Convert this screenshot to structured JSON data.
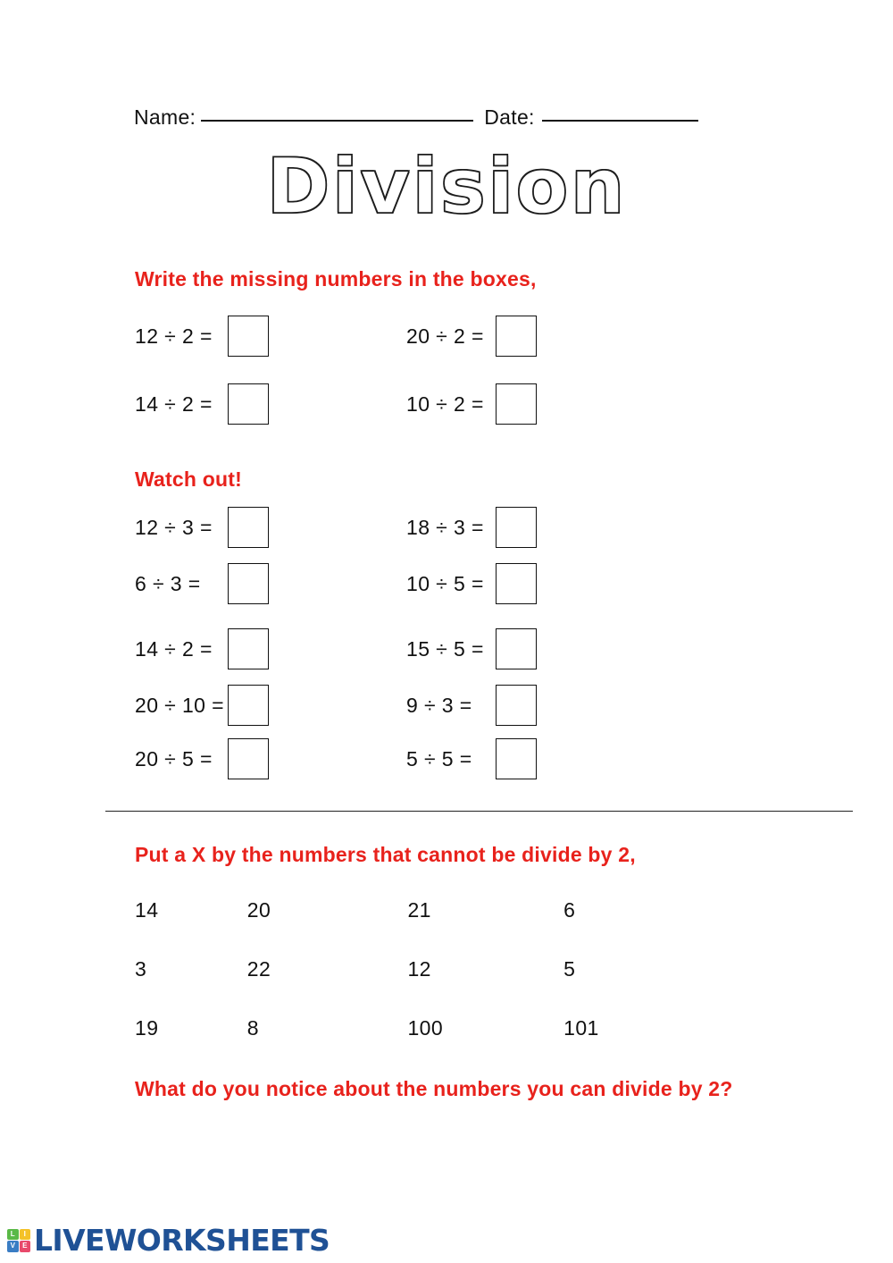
{
  "header": {
    "name_label": "Name:",
    "date_label": "Date:",
    "name_value": "",
    "date_value": ""
  },
  "title": "Division",
  "colors": {
    "instruction_red": "#e8221c",
    "text_black": "#111111",
    "logo_navy": "#1f5195",
    "tile_green": "#5ab947",
    "tile_yellow": "#f4c228",
    "tile_blue": "#3a7dc4",
    "tile_pink": "#e8496b"
  },
  "sections": {
    "section1": {
      "instruction": "Write the missing numbers in the boxes,",
      "left": [
        {
          "text": "12 ÷ 2 =",
          "answer": ""
        },
        {
          "text": "14 ÷ 2 =",
          "answer": ""
        }
      ],
      "right": [
        {
          "text": "20 ÷ 2 =",
          "answer": ""
        },
        {
          "text": "10 ÷ 2 =",
          "answer": ""
        }
      ]
    },
    "section2": {
      "instruction": "Watch out!",
      "left": [
        {
          "text": "12 ÷ 3 =",
          "answer": ""
        },
        {
          "text": "6 ÷ 3 =",
          "answer": ""
        },
        {
          "text": "14 ÷ 2 =",
          "answer": ""
        },
        {
          "text": "20 ÷ 10 =",
          "answer": ""
        },
        {
          "text": "20 ÷ 5 =",
          "answer": ""
        }
      ],
      "right": [
        {
          "text": "18 ÷ 3 =",
          "answer": ""
        },
        {
          "text": "10 ÷ 5 =",
          "answer": ""
        },
        {
          "text": "15 ÷ 5 =",
          "answer": ""
        },
        {
          "text": "9 ÷ 3 =",
          "answer": ""
        },
        {
          "text": "5 ÷ 5 =",
          "answer": ""
        }
      ]
    },
    "section3": {
      "instruction": "Put a X by the numbers that cannot be divide by 2,",
      "grid": [
        [
          "14",
          "20",
          "21",
          "6"
        ],
        [
          "3",
          "22",
          "12",
          "5"
        ],
        [
          "19",
          "8",
          "100",
          "101"
        ]
      ],
      "closing_question": "What do you notice about the numbers you can divide by 2?"
    }
  },
  "footer": {
    "tiles": [
      "L",
      "I",
      "V",
      "E"
    ],
    "brand": "LIVEWORKSHEETS"
  }
}
